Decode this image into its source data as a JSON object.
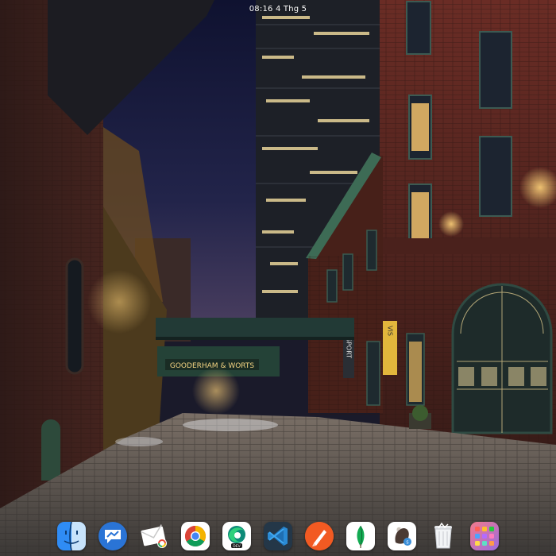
{
  "topbar": {
    "clock": "08:16  4 Thg 5"
  },
  "wallpaper": {
    "signs": {
      "bridge": "GOODERHAM & WORTS",
      "sport": "SPORT",
      "vis": "VIS"
    }
  },
  "dock": {
    "items": [
      {
        "icon": "finder-icon"
      },
      {
        "icon": "messages-icon"
      },
      {
        "icon": "mail-icon"
      },
      {
        "icon": "chrome-icon"
      },
      {
        "icon": "edge-dev-icon"
      },
      {
        "icon": "vscode-icon"
      },
      {
        "icon": "paw-icon"
      },
      {
        "icon": "mongodb-compass-icon"
      },
      {
        "icon": "sequel-pro-icon"
      },
      {
        "icon": "trash-icon"
      },
      {
        "icon": "launchpad-icon"
      }
    ]
  },
  "colors": {
    "sky": "#14172e",
    "brick": "#5a2a22",
    "glow": "#f3b451",
    "street": "#4b4643"
  }
}
